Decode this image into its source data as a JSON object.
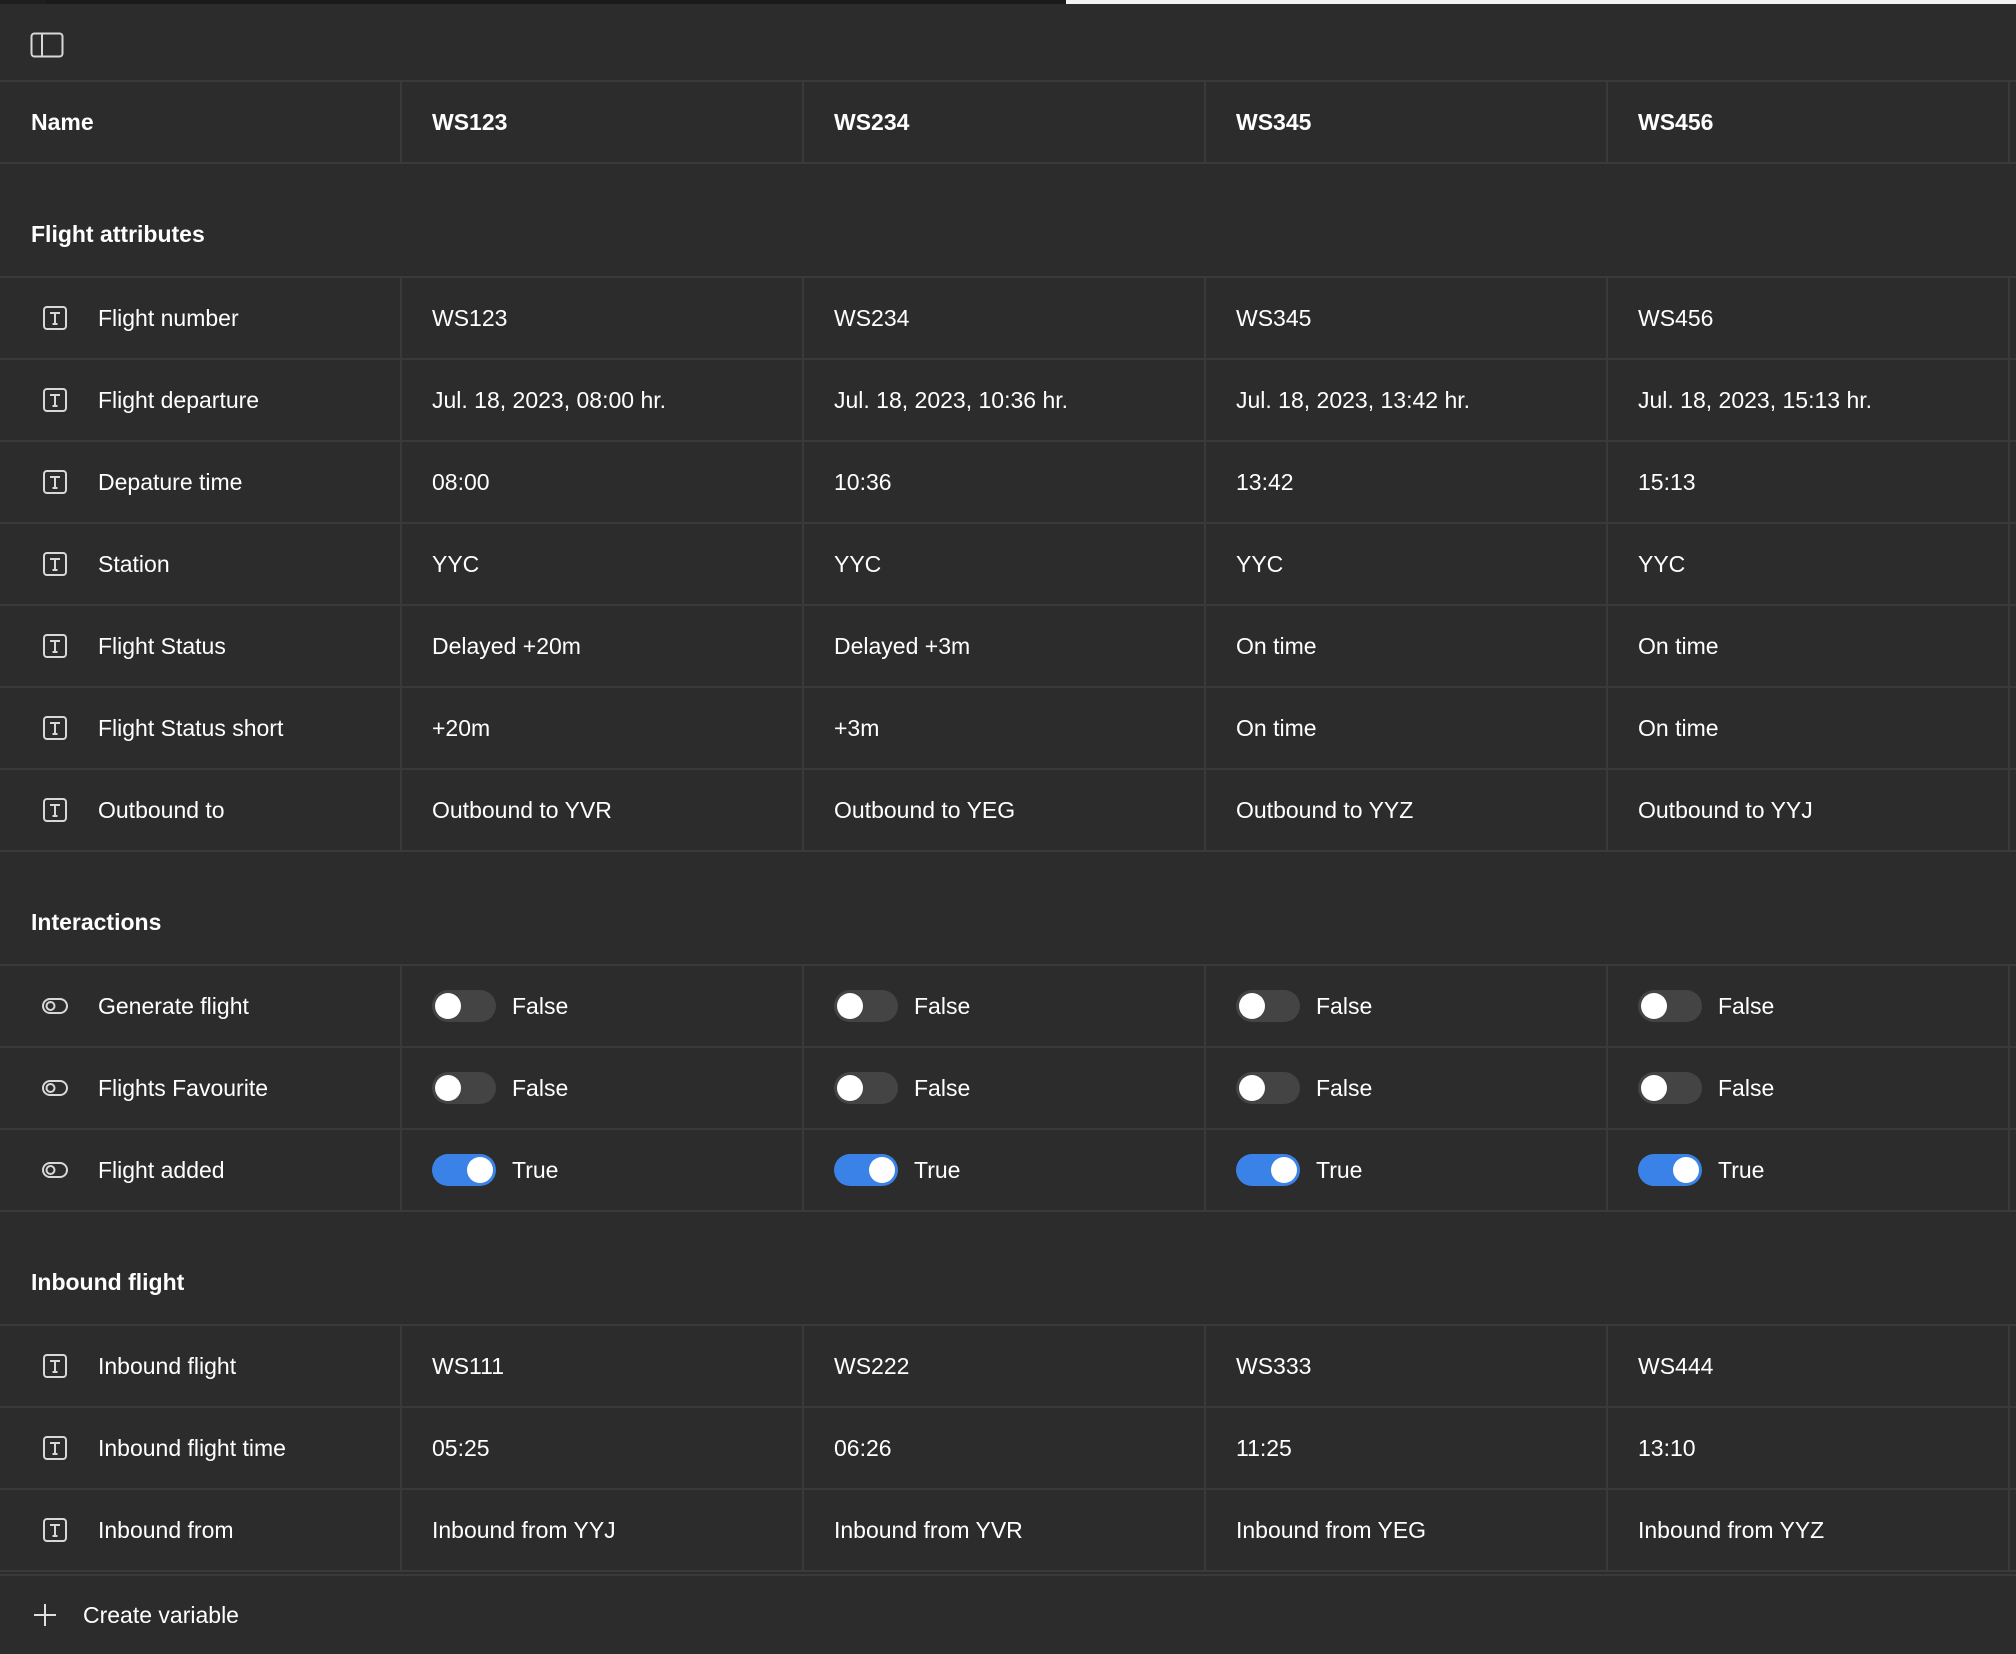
{
  "header": {
    "name_col": "Name",
    "modes": [
      "WS123",
      "WS234",
      "WS345",
      "WS456"
    ]
  },
  "groups": [
    {
      "title": "Flight attributes",
      "rows": [
        {
          "name": "Flight number",
          "type": "text",
          "values": [
            "WS123",
            "WS234",
            "WS345",
            "WS456"
          ]
        },
        {
          "name": "Flight departure",
          "type": "text",
          "values": [
            "Jul. 18, 2023, 08:00 hr.",
            "Jul. 18, 2023, 10:36 hr.",
            "Jul. 18, 2023, 13:42 hr.",
            "Jul. 18, 2023, 15:13 hr."
          ]
        },
        {
          "name": "Depature time",
          "type": "text",
          "values": [
            "08:00",
            "10:36",
            "13:42",
            "15:13"
          ]
        },
        {
          "name": "Station",
          "type": "text",
          "values": [
            "YYC",
            "YYC",
            "YYC",
            "YYC"
          ]
        },
        {
          "name": "Flight Status",
          "type": "text",
          "values": [
            "Delayed +20m",
            "Delayed +3m",
            "On time",
            "On time"
          ]
        },
        {
          "name": "Flight Status short",
          "type": "text",
          "values": [
            "+20m",
            "+3m",
            "On time",
            "On time"
          ]
        },
        {
          "name": "Outbound to",
          "type": "text",
          "values": [
            "Outbound to YVR",
            "Outbound to YEG",
            "Outbound to YYZ",
            "Outbound to YYJ"
          ]
        }
      ]
    },
    {
      "title": "Interactions",
      "rows": [
        {
          "name": "Generate flight",
          "type": "boolean",
          "values": [
            "False",
            "False",
            "False",
            "False"
          ]
        },
        {
          "name": "Flights Favourite",
          "type": "boolean",
          "values": [
            "False",
            "False",
            "False",
            "False"
          ]
        },
        {
          "name": "Flight added",
          "type": "boolean",
          "values": [
            "True",
            "True",
            "True",
            "True"
          ]
        }
      ]
    },
    {
      "title": "Inbound flight",
      "rows": [
        {
          "name": "Inbound flight",
          "type": "text",
          "values": [
            "WS111",
            "WS222",
            "WS333",
            "WS444"
          ]
        },
        {
          "name": "Inbound flight time",
          "type": "text",
          "values": [
            "05:25",
            "06:26",
            "11:25",
            "13:10"
          ]
        },
        {
          "name": "Inbound from",
          "type": "text",
          "values": [
            "Inbound from YYJ",
            "Inbound from YVR",
            "Inbound from YEG",
            "Inbound from YYZ"
          ]
        }
      ]
    }
  ],
  "footer": {
    "create_label": "Create variable"
  },
  "icons": {
    "text_type": "text-type-icon",
    "boolean_type": "boolean-type-icon",
    "sidebar_toggle": "sidebar-toggle-icon",
    "plus": "plus-icon"
  },
  "colors": {
    "background": "#2c2c2c",
    "divider": "#3a3a3a",
    "toggle_on": "#3b82e8",
    "toggle_off": "#444444"
  }
}
